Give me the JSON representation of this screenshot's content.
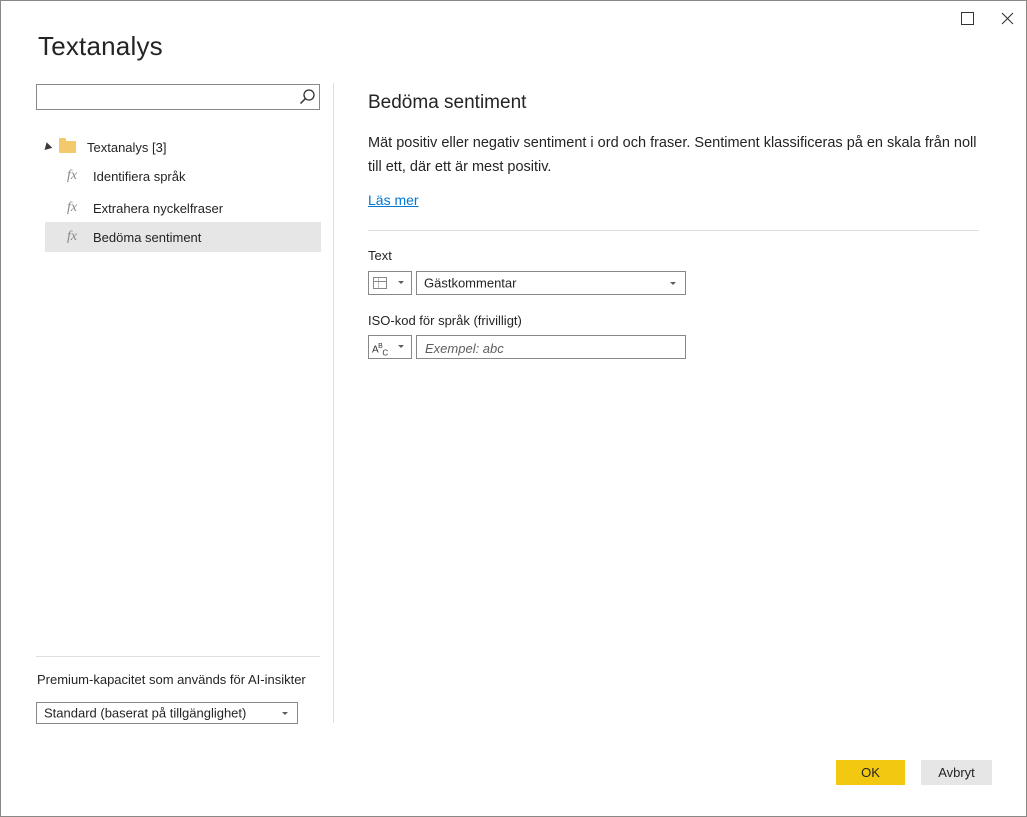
{
  "dialog": {
    "title": "Textanalys",
    "maximize_icon": "maximize-icon",
    "close_icon": "close-icon"
  },
  "search": {
    "placeholder": "",
    "icon": "search-icon"
  },
  "tree": {
    "root_label": "Textanalys [3]",
    "items": [
      {
        "label": "Identifiera språk",
        "icon": "function-icon"
      },
      {
        "label": "Extrahera nyckelfraser",
        "icon": "function-icon"
      },
      {
        "label": "Bedöma sentiment",
        "icon": "function-icon",
        "selected": true
      }
    ]
  },
  "capacity": {
    "label": "Premium-kapacitet som används för AI-insikter",
    "selected": "Standard (baserat på tillgänglighet)"
  },
  "detail": {
    "title": "Bedöma sentiment",
    "description": "Mät positiv eller negativ sentiment i ord och fraser. Sentiment klassificeras på en skala från noll till ett, där ett är mest positiv.",
    "learn_more": "Läs mer",
    "text_field": {
      "label": "Text",
      "type_icon": "table-column-icon",
      "selected": "Gästkommentar"
    },
    "iso_field": {
      "label": "ISO-kod för språk (frivilligt)",
      "type_icon": "abc-text-icon",
      "type_icon_text": "ABC",
      "placeholder": "Exempel: abc",
      "value": ""
    }
  },
  "buttons": {
    "ok": "OK",
    "cancel": "Avbryt"
  },
  "colors": {
    "accent": "#f2c811",
    "link": "#0078d4",
    "selected_row": "#e6e6e6",
    "folder": "#f3c96b"
  }
}
